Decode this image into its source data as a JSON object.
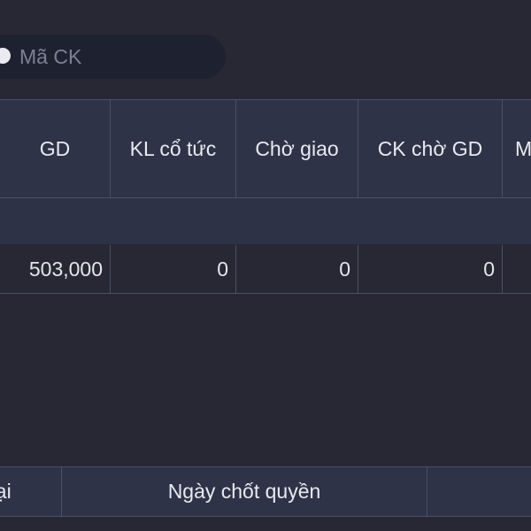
{
  "search": {
    "placeholder": "Mã CK",
    "value": ""
  },
  "holdings_table": {
    "columns": [
      "GD",
      "KL cổ tức",
      "Chờ giao",
      "CK chờ GD",
      "M"
    ],
    "rows": [
      [
        "503,000",
        "0",
        "0",
        "0",
        ""
      ]
    ]
  },
  "rights_table": {
    "columns": [
      "oại",
      "Ngày chốt quyền",
      ""
    ]
  },
  "colors": {
    "background": "#272833",
    "header_bg": "#2e3347",
    "border": "#4a5068",
    "search_bg": "#1e2130"
  }
}
